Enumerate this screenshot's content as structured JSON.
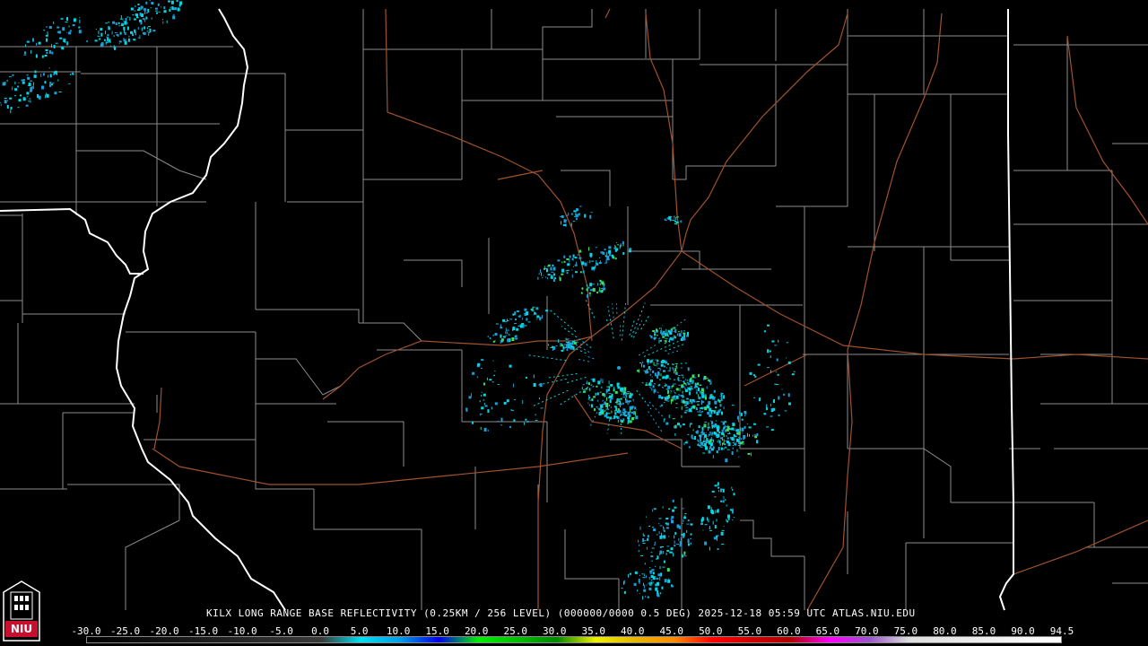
{
  "product": {
    "caption": "KILX LONG RANGE BASE REFLECTIVITY (0.25KM / 256 LEVEL) (000000/0000 0.5 DEG) 2025-12-18 05:59 UTC  ATLAS.NIU.EDU"
  },
  "logo": {
    "text": "NIU",
    "color": "#c8102e"
  },
  "colorbar": {
    "labels": [
      "-30.0",
      "-25.0",
      "-20.0",
      "-15.0",
      "-10.0",
      "-5.0",
      "0.0",
      "5.0",
      "10.0",
      "15.0",
      "20.0",
      "25.0",
      "30.0",
      "35.0",
      "40.0",
      "45.0",
      "50.0",
      "55.0",
      "60.0",
      "65.0",
      "70.0",
      "75.0",
      "80.0",
      "85.0",
      "90.0",
      "94.5"
    ],
    "stops": [
      {
        "dbz": -30,
        "color": "#000000"
      },
      {
        "dbz": 0,
        "color": "#3a3a3a"
      },
      {
        "dbz": 5,
        "color": "#00e0f0"
      },
      {
        "dbz": 10,
        "color": "#009ee8"
      },
      {
        "dbz": 15,
        "color": "#0000e6"
      },
      {
        "dbz": 20,
        "color": "#00f000"
      },
      {
        "dbz": 25,
        "color": "#00c000"
      },
      {
        "dbz": 30,
        "color": "#008800"
      },
      {
        "dbz": 35,
        "color": "#f0f000"
      },
      {
        "dbz": 40,
        "color": "#e6b800"
      },
      {
        "dbz": 45,
        "color": "#ff8c00"
      },
      {
        "dbz": 50,
        "color": "#ff0000"
      },
      {
        "dbz": 55,
        "color": "#d00000"
      },
      {
        "dbz": 60,
        "color": "#b00000"
      },
      {
        "dbz": 65,
        "color": "#ff00ff"
      },
      {
        "dbz": 70,
        "color": "#9955c9"
      },
      {
        "dbz": 75,
        "color": "#dddddd"
      },
      {
        "dbz": 94.5,
        "color": "#ffffff"
      }
    ]
  },
  "colors": {
    "state_border": "#ffffff",
    "county_border": "#8c8c8c",
    "highway": "#a0522d",
    "echo_light": "#00d8e8",
    "echo_mid": "#1a9fd8",
    "echo_green": "#3ee05a"
  }
}
